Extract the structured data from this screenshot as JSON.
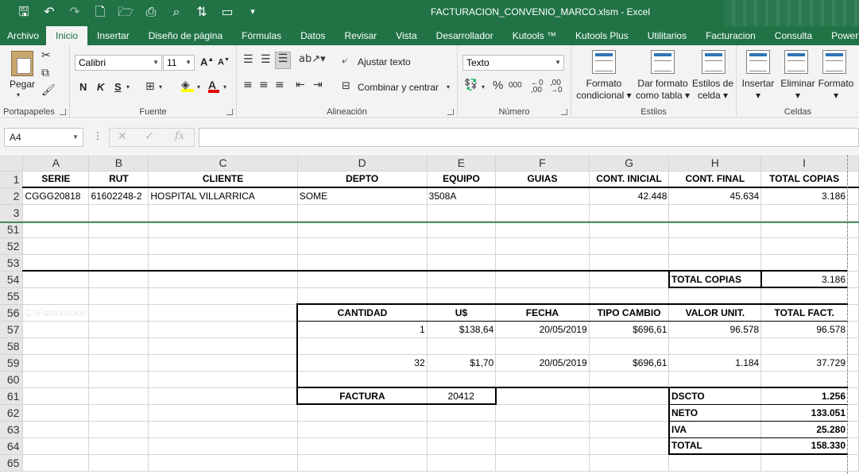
{
  "window": {
    "title": "FACTURACION_CONVENIO_MARCO.xlsm - Excel"
  },
  "qat": [
    "save-icon",
    "undo-icon",
    "redo-icon",
    "new-icon",
    "open-icon",
    "print-icon",
    "preview-icon",
    "sort-icon",
    "form-icon",
    "more-icon"
  ],
  "tabs": [
    "Archivo",
    "Inicio",
    "Insertar",
    "Diseño de página",
    "Fórmulas",
    "Datos",
    "Revisar",
    "Vista",
    "Desarrollador",
    "Kutools ™",
    "Kutools Plus",
    "Utilitarios",
    "Facturacion",
    "Consulta",
    "Power Piv"
  ],
  "ribbon": {
    "clipboard": {
      "paste": "Pegar",
      "label": "Portapapeles"
    },
    "font": {
      "name": "Calibri",
      "size": "11",
      "grow": "A",
      "shrink": "A",
      "bold": "N",
      "italic": "K",
      "underline": "S",
      "label": "Fuente"
    },
    "alignment": {
      "wrap": "Ajustar texto",
      "merge": "Combinar y centrar",
      "label": "Alineación"
    },
    "number": {
      "format": "Texto",
      "label": "Número"
    },
    "styles": {
      "conditional1": "Formato",
      "conditional2": "condicional",
      "table1": "Dar formato",
      "table2": "como tabla",
      "cell1": "Estilos de",
      "cell2": "celda",
      "label": "Estilos"
    },
    "cells": {
      "insert": "Insertar",
      "delete": "Eliminar",
      "format": "Formato",
      "label": "Celdas"
    }
  },
  "formula_bar": {
    "namebox": "A4",
    "fx": "fx",
    "value": ""
  },
  "accent": "#217346",
  "columns": [
    "A",
    "B",
    "C",
    "D",
    "E",
    "F",
    "G",
    "H",
    "I"
  ],
  "rows": {
    "r1": {
      "num": "1",
      "A": "SERIE",
      "B": "RUT",
      "C": "CLIENTE",
      "D": "DEPTO",
      "E": "EQUIPO",
      "F": "GUIAS",
      "G": "CONT. INICIAL",
      "H": "CONT. FINAL",
      "I": "TOTAL COPIAS"
    },
    "r2": {
      "num": "2",
      "A": "CGGG20818",
      "B": "61602248-2",
      "C": "HOSPITAL VILLARRICA",
      "D": "SOME",
      "E": "3508A",
      "F": "",
      "G": "42.448",
      "H": "45.634",
      "I": "3.186"
    },
    "r3": {
      "num": "3"
    },
    "r51": {
      "num": "51"
    },
    "r52": {
      "num": "52"
    },
    "r53": {
      "num": "53"
    },
    "r54": {
      "num": "54",
      "H": "TOTAL COPIAS",
      "I": "3.186"
    },
    "r55": {
      "num": "55"
    },
    "r56": {
      "num": "56",
      "A": "C:\\Facturacion",
      "D": "CANTIDAD",
      "E": "U$",
      "F": "FECHA",
      "G": "TIPO CAMBIO",
      "H": "VALOR UNIT.",
      "I": "TOTAL FACT."
    },
    "r57": {
      "num": "57",
      "D": "1",
      "E": "$138,64",
      "F": "20/05/2019",
      "G": "$696,61",
      "H": "96.578",
      "I": "96.578"
    },
    "r58": {
      "num": "58"
    },
    "r59": {
      "num": "59",
      "D": "32",
      "E": "$1,70",
      "F": "20/05/2019",
      "G": "$696,61",
      "H": "1.184",
      "I": "37.729"
    },
    "r60": {
      "num": "60"
    },
    "r61": {
      "num": "61",
      "D": "FACTURA",
      "E": "20412",
      "H": "DSCTO",
      "I": "1.256"
    },
    "r62": {
      "num": "62",
      "H": "NETO",
      "I": "133.051"
    },
    "r63": {
      "num": "63",
      "H": "IVA",
      "I": "25.280"
    },
    "r64": {
      "num": "64",
      "H": "TOTAL",
      "I": "158.330"
    },
    "r65": {
      "num": "65"
    }
  }
}
